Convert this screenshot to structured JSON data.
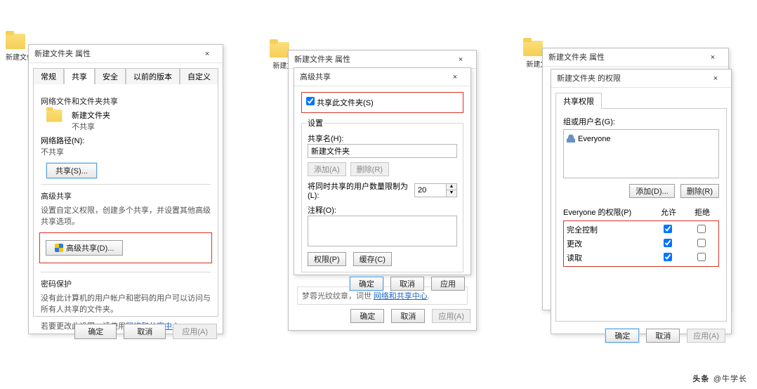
{
  "desktop": {
    "folder_label": "新建文件夹",
    "folder_label2": "新建文(",
    "folder_label3": "新建文("
  },
  "d1": {
    "title": "新建文件夹 属性",
    "tabs": [
      "常规",
      "共享",
      "安全",
      "以前的版本",
      "自定义"
    ],
    "sec1": {
      "header": "网络文件和文件夹共享",
      "name": "新建文件夹",
      "status": "不共享",
      "path_label": "网络路径(N):",
      "path_value": "不共享",
      "share_btn": "共享(S)..."
    },
    "sec2": {
      "header": "高级共享",
      "desc": "设置自定义权限，创建多个共享，并设置其他高级共享选项。",
      "adv_btn": "高级共享(D)..."
    },
    "sec3": {
      "header": "密码保护",
      "line1": "没有此计算机的用户帐户和密码的用户可以访问与所有人共享的文件夹。",
      "line2_a": "若要更改此设置，请使用",
      "line2_link": "网络和共享中心",
      "line2_b": "。"
    },
    "ok": "确定",
    "cancel": "取消",
    "apply": "应用(A)"
  },
  "d2": {
    "parent_title": "新建文件夹 属性",
    "title": "高级共享",
    "share_checkbox": "共享此文件夹(S)",
    "settings": "设置",
    "sharename_label": "共享名(H):",
    "sharename_value": "新建文件夹",
    "add": "添加(A)",
    "remove": "删除(R)",
    "limit_label": "将同时共享的用户数量限制为(L):",
    "limit_value": "20",
    "comment_label": "注释(O):",
    "perm_btn": "权限(P)",
    "cache_btn": "缓存(C)",
    "parent_stub": "梦蓉光纹纹章，词世",
    "parent_link": "网络和共享中心",
    "ok": "确定",
    "cancel": "取消",
    "apply": "应用",
    "p_ok": "确定",
    "p_cancel": "取消",
    "p_apply": "应用(A)"
  },
  "d3": {
    "parent_title": "新建文件夹 属性",
    "title": "新建文件夹 的权限",
    "section": "共享权限",
    "group_label": "组或用户名(G):",
    "user": "Everyone",
    "add": "添加(D)...",
    "remove": "删除(R)",
    "perm_header_label": "Everyone 的权限(P)",
    "col_allow": "允许",
    "col_deny": "拒绝",
    "perms": [
      "完全控制",
      "更改",
      "读取"
    ],
    "ok": "确定",
    "cancel": "取消",
    "apply": "应用(A)"
  },
  "watermark": {
    "head": "头条",
    "at": "@",
    "name": "牛学长"
  }
}
